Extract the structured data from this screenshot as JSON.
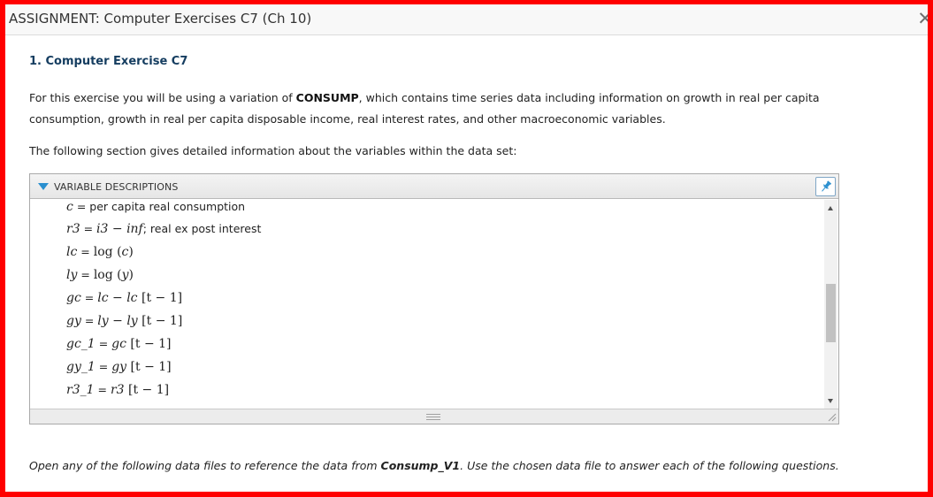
{
  "window": {
    "title": "ASSIGNMENT: Computer Exercises C7 (Ch 10)",
    "close_glyph": "✕"
  },
  "question": {
    "heading": "1. Computer Exercise C7",
    "intro_pre": "For this exercise you will be using a variation of ",
    "intro_dataset": "CONSUMP",
    "intro_post": ", which contains time series data including information on growth in real per capita consumption, growth in real per capita disposable income, real interest rates, and other macroeconomic variables.",
    "section_text": "The following section gives detailed information about the variables within the data set:"
  },
  "panel": {
    "title": "VARIABLE DESCRIPTIONS",
    "pin_icon": "pin-icon",
    "variables": [
      {
        "lhs": "c",
        "eq": " = ",
        "rhs_text": "per capita real consumption"
      },
      {
        "lhs": "r3",
        "eq": " = ",
        "rhs_math_a": "i3",
        "rhs_math_op": " − ",
        "rhs_math_b": "inf",
        "rhs_text": "; real ex post interest"
      },
      {
        "lhs": "lc",
        "eq": " = ",
        "rhs_fn": "log",
        "rhs_arg": "c"
      },
      {
        "lhs": "ly",
        "eq": " = ",
        "rhs_fn": "log",
        "rhs_arg": "y"
      },
      {
        "lhs": "gc",
        "eq": " = ",
        "rhs_a": "lc",
        "rhs_op": " − ",
        "rhs_b": "lc",
        "rhs_lag": "t − 1"
      },
      {
        "lhs": "gy",
        "eq": " = ",
        "rhs_a": "ly",
        "rhs_op": " − ",
        "rhs_b": "ly",
        "rhs_lag": "t − 1"
      },
      {
        "lhs": "gc_1",
        "eq": " = ",
        "rhs_b": "gc",
        "rhs_lag": "t − 1"
      },
      {
        "lhs": "gy_1",
        "eq": " = ",
        "rhs_b": "gy",
        "rhs_lag": "t − 1"
      },
      {
        "lhs": "r3_1",
        "eq": " = ",
        "rhs_b": "r3",
        "rhs_lag": "t − 1"
      }
    ]
  },
  "footer": {
    "text_pre": "Open any of the following data files to reference the data from ",
    "dataset": "Consump_V1",
    "text_post": ". Use the chosen data file to answer each of the following questions."
  },
  "colors": {
    "frame": "#ff0000",
    "heading": "#153d60",
    "accent": "#2a8fcf"
  }
}
